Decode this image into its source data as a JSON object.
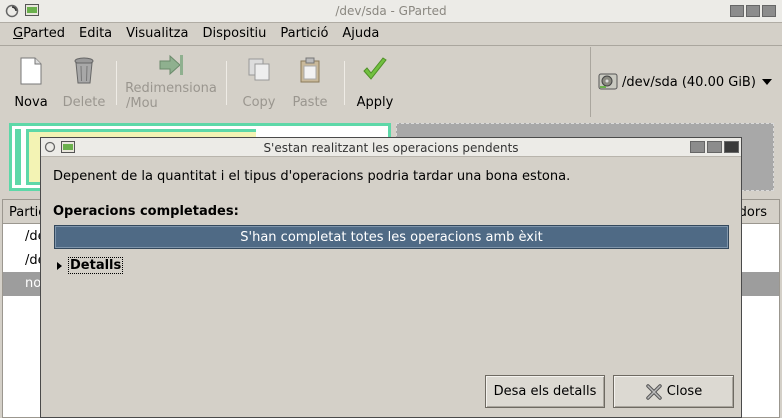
{
  "window": {
    "title": "/dev/sda - GParted"
  },
  "menubar": {
    "items": [
      {
        "label": "GParted"
      },
      {
        "label": "Edita"
      },
      {
        "label": "Visualitza"
      },
      {
        "label": "Dispositiu"
      },
      {
        "label": "Partició"
      },
      {
        "label": "Ajuda"
      }
    ]
  },
  "toolbar": {
    "new_label": "Nova",
    "delete_label": "Delete",
    "resize_label_1": "Redimensiona",
    "resize_label_2": "/Mou",
    "copy_label": "Copy",
    "paste_label": "Paste",
    "apply_label": "Apply"
  },
  "device": {
    "label": "/dev/sda  (40.00 GiB)"
  },
  "partition_list": {
    "col_partition": "Partic",
    "col_flags": "dors",
    "rows": [
      {
        "name": "/de"
      },
      {
        "name": "/de"
      },
      {
        "name": "no"
      }
    ]
  },
  "dialog": {
    "title": "S'estan realitzant les operacions pendents",
    "message": "Depenent de la quantitat i el tipus d'operacions podria tardar una bona estona.",
    "ops_heading": "Operacions completades:",
    "progress_text": "S'han completat totes les operacions amb èxit",
    "progress_fraction": 1.0,
    "details_label": "Detalls",
    "save_label": "Desa els detalls",
    "close_label": "Close"
  },
  "colors": {
    "partition_border": "#5dd8a8",
    "used_space": "#f3f3b4",
    "unallocated": "#a8a8a8",
    "progress": "#4f6a85"
  }
}
